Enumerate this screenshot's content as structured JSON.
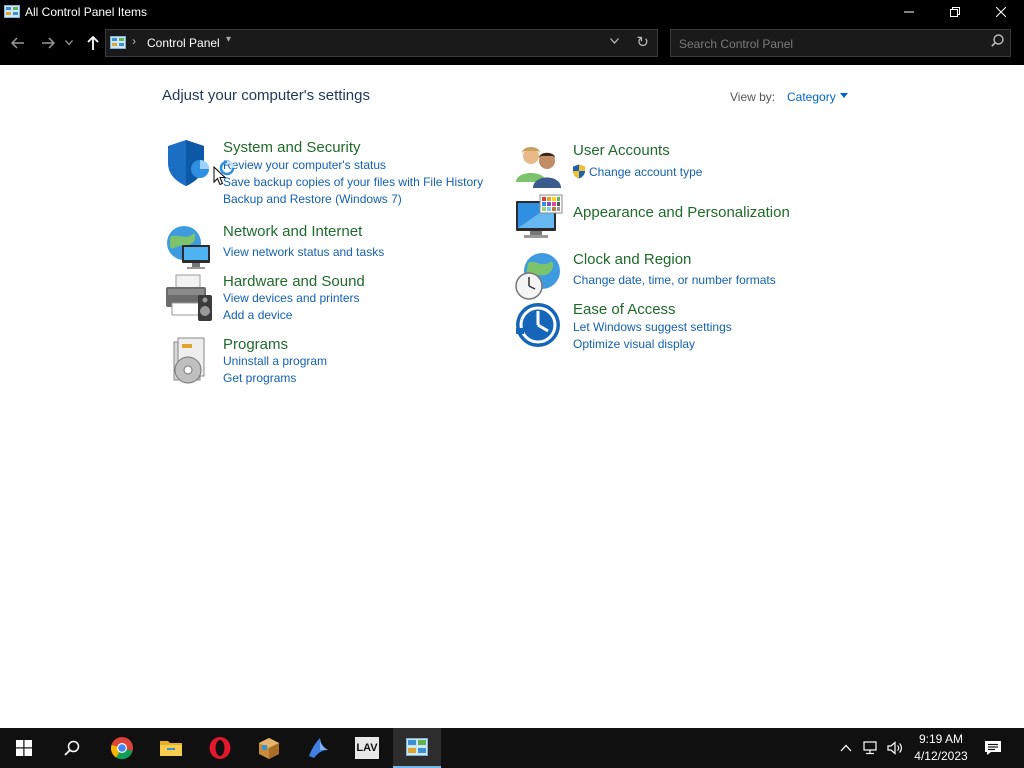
{
  "window": {
    "title": "All Control Panel Items",
    "controls": [
      "minimize",
      "restore",
      "close"
    ]
  },
  "nav": {
    "back_icon": "back-arrow-icon",
    "forward_icon": "forward-arrow-icon",
    "up_icon": "up-arrow-icon",
    "address": "Control Panel",
    "search_placeholder": "Search Control Panel"
  },
  "main": {
    "heading": "Adjust your computer's settings",
    "view_by_label": "View by:",
    "view_by_value": "Category",
    "categories": [
      {
        "title": "System and Security",
        "icon": "shield-icon",
        "links": [
          "Review your computer's status",
          "Save backup copies of your files with File History",
          "Backup and Restore (Windows 7)"
        ]
      },
      {
        "title": "Network and Internet",
        "icon": "network-globe-icon",
        "links": [
          "View network status and tasks"
        ]
      },
      {
        "title": "Hardware and Sound",
        "icon": "printer-speaker-icon",
        "links": [
          "View devices and printers",
          "Add a device"
        ]
      },
      {
        "title": "Programs",
        "icon": "programs-disc-icon",
        "links": [
          "Uninstall a program",
          "Get programs"
        ]
      },
      {
        "title": "User Accounts",
        "icon": "users-icon",
        "links": [
          "Change account type"
        ]
      },
      {
        "title": "Appearance and Personalization",
        "icon": "monitor-palette-icon",
        "links": []
      },
      {
        "title": "Clock and Region",
        "icon": "clock-globe-icon",
        "links": [
          "Change date, time, or number formats"
        ]
      },
      {
        "title": "Ease of Access",
        "icon": "ease-of-access-icon",
        "links": [
          "Let Windows suggest settings",
          "Optimize visual display"
        ]
      }
    ]
  },
  "taskbar": {
    "apps": [
      "start-icon",
      "search-icon",
      "chrome-icon",
      "file-explorer-icon",
      "opera-icon",
      "package-icon",
      "bird-app-icon",
      "lav-app-icon",
      "control-panel-icon"
    ],
    "lav_label": "LAV",
    "time": "9:19 AM",
    "date": "4/12/2023"
  }
}
